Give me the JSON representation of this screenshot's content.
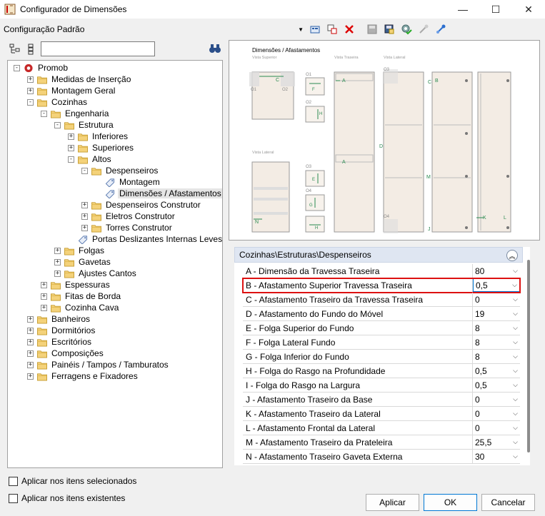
{
  "window": {
    "title": "Configurador de Dimensões"
  },
  "config": {
    "selected": "Configuração Padrão"
  },
  "search": {
    "value": ""
  },
  "tree": {
    "items": [
      {
        "label": "Promob",
        "depth": 0,
        "exp": "-",
        "icon": "promob"
      },
      {
        "label": "Medidas de Inserção",
        "depth": 1,
        "exp": "+",
        "icon": "folder"
      },
      {
        "label": "Montagem Geral",
        "depth": 1,
        "exp": "+",
        "icon": "folder"
      },
      {
        "label": "Cozinhas",
        "depth": 1,
        "exp": "-",
        "icon": "folder"
      },
      {
        "label": "Engenharia",
        "depth": 2,
        "exp": "-",
        "icon": "folder"
      },
      {
        "label": "Estrutura",
        "depth": 3,
        "exp": "-",
        "icon": "folder"
      },
      {
        "label": "Inferiores",
        "depth": 4,
        "exp": "+",
        "icon": "folder"
      },
      {
        "label": "Superiores",
        "depth": 4,
        "exp": "+",
        "icon": "folder"
      },
      {
        "label": "Altos",
        "depth": 4,
        "exp": "-",
        "icon": "folder"
      },
      {
        "label": "Despenseiros",
        "depth": 5,
        "exp": "-",
        "icon": "folder"
      },
      {
        "label": "Montagem",
        "depth": 6,
        "exp": "",
        "icon": "tag"
      },
      {
        "label": "Dimensões / Afastamentos",
        "depth": 6,
        "exp": "",
        "icon": "tag",
        "selected": true
      },
      {
        "label": "Despenseiros Construtor",
        "depth": 5,
        "exp": "+",
        "icon": "folder"
      },
      {
        "label": "Eletros Construtor",
        "depth": 5,
        "exp": "+",
        "icon": "folder"
      },
      {
        "label": "Torres Construtor",
        "depth": 5,
        "exp": "+",
        "icon": "folder"
      },
      {
        "label": "Portas Deslizantes Internas Leves",
        "depth": 4,
        "exp": "",
        "icon": "tag"
      },
      {
        "label": "Folgas",
        "depth": 3,
        "exp": "+",
        "icon": "folder"
      },
      {
        "label": "Gavetas",
        "depth": 3,
        "exp": "+",
        "icon": "folder"
      },
      {
        "label": "Ajustes Cantos",
        "depth": 3,
        "exp": "+",
        "icon": "folder"
      },
      {
        "label": "Espessuras",
        "depth": 2,
        "exp": "+",
        "icon": "folder"
      },
      {
        "label": "Fitas de Borda",
        "depth": 2,
        "exp": "+",
        "icon": "folder"
      },
      {
        "label": "Cozinha Cava",
        "depth": 2,
        "exp": "+",
        "icon": "folder"
      },
      {
        "label": "Banheiros",
        "depth": 1,
        "exp": "+",
        "icon": "folder"
      },
      {
        "label": "Dormitórios",
        "depth": 1,
        "exp": "+",
        "icon": "folder"
      },
      {
        "label": "Escritórios",
        "depth": 1,
        "exp": "+",
        "icon": "folder"
      },
      {
        "label": "Composições",
        "depth": 1,
        "exp": "+",
        "icon": "folder"
      },
      {
        "label": "Painéis / Tampos / Tamburatos",
        "depth": 1,
        "exp": "+",
        "icon": "folder"
      },
      {
        "label": "Ferragens e Fixadores",
        "depth": 1,
        "exp": "+",
        "icon": "folder"
      }
    ]
  },
  "checks": {
    "selected_items": "Aplicar nos itens selecionados",
    "existing_items": "Aplicar nos itens existentes"
  },
  "preview": {
    "title": "Dimensões / Afastamentos",
    "vista_superior": "Vista Superior",
    "vista_traseira": "Vista Traseira",
    "vista_lateral_top": "Vista Lateral",
    "vista_lateral": "Vista Lateral",
    "labels": {
      "o1": "O1",
      "o2": "O2",
      "o3": "O3",
      "o4": "O4",
      "c": "C",
      "a1": "A",
      "a2": "A",
      "b": "B",
      "c2": "C",
      "d": "D",
      "m": "M",
      "j": "J",
      "k": "K",
      "l": "L",
      "n": "N",
      "f": "F",
      "e": "E",
      "g": "G",
      "h": "H"
    }
  },
  "grid": {
    "header": "Cozinhas\\Estruturas\\Despenseiros",
    "rows": [
      {
        "name": "A - Dimensão da Travessa Traseira",
        "value": "80"
      },
      {
        "name": "B - Afastamento Superior Travessa Traseira",
        "value": "0,5",
        "highlight": true
      },
      {
        "name": "C - Afastamento Traseiro da Travessa Traseira",
        "value": "0"
      },
      {
        "name": "D - Afastamento do Fundo do Móvel",
        "value": "19"
      },
      {
        "name": "E - Folga Superior do Fundo",
        "value": "8"
      },
      {
        "name": "F - Folga Lateral Fundo",
        "value": "8"
      },
      {
        "name": "G - Folga Inferior do Fundo",
        "value": "8"
      },
      {
        "name": "H - Folga do Rasgo na Profundidade",
        "value": "0,5"
      },
      {
        "name": "I - Folga do Rasgo na Largura",
        "value": "0,5"
      },
      {
        "name": "J - Afastamento Traseiro da Base",
        "value": "0"
      },
      {
        "name": "K - Afastamento Traseiro da Lateral",
        "value": "0"
      },
      {
        "name": "L - Afastamento Frontal da Lateral",
        "value": "0"
      },
      {
        "name": "M - Afastamento Traseiro da Prateleira",
        "value": "25,5"
      },
      {
        "name": "N - Afastamento Traseiro Gaveta Externa",
        "value": "30"
      }
    ]
  },
  "buttons": {
    "apply": "Aplicar",
    "ok": "OK",
    "cancel": "Cancelar"
  }
}
